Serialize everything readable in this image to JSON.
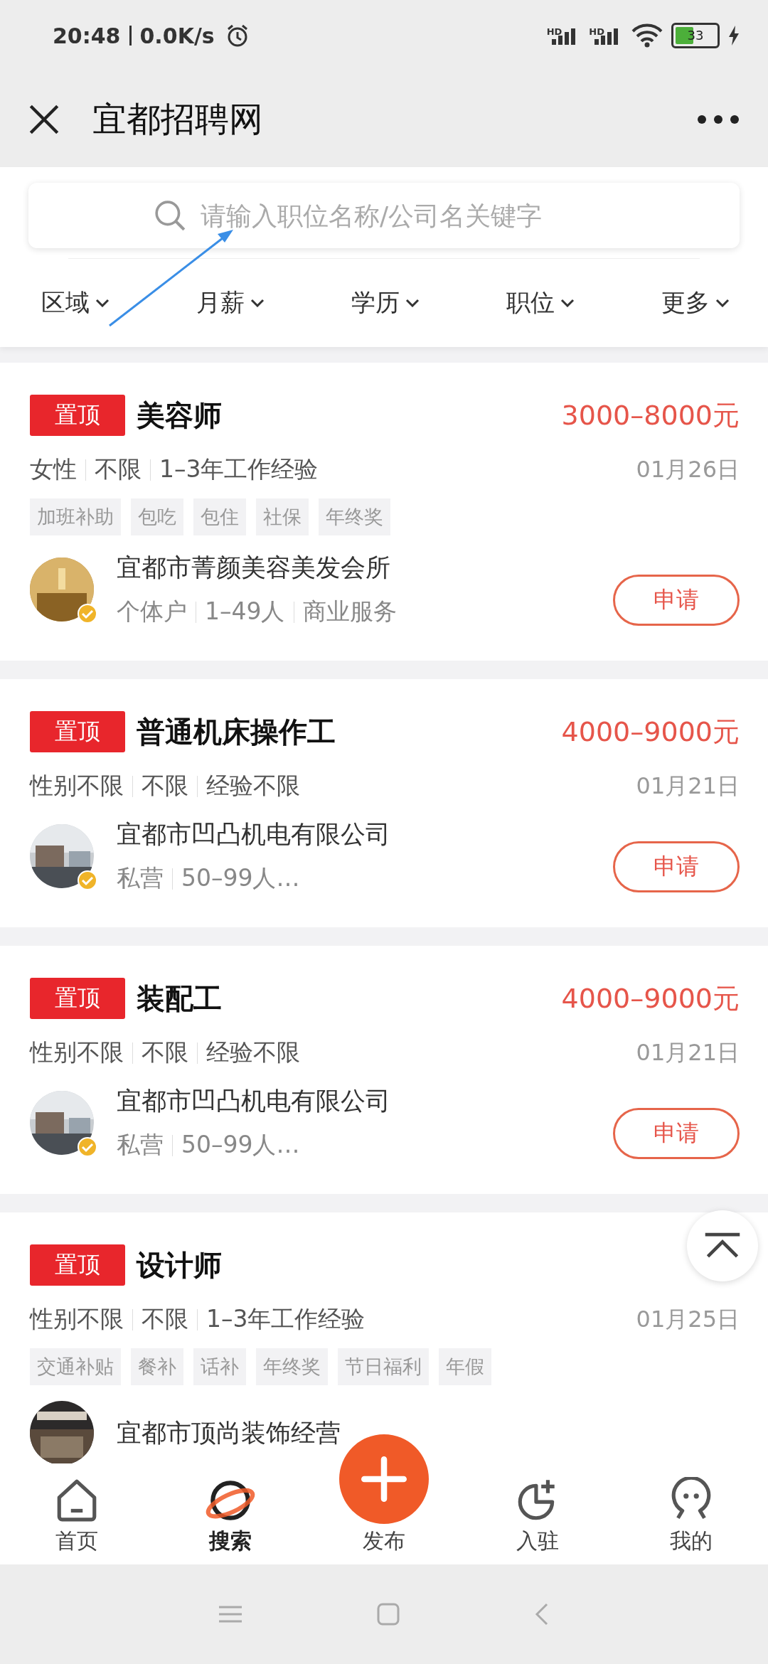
{
  "status_bar": {
    "time": "20:48",
    "speed": "0.0K/s",
    "network": [
      "HD",
      "HD"
    ],
    "battery": "33",
    "charging": true
  },
  "title_bar": {
    "title": "宜都招聘网"
  },
  "search": {
    "placeholder": "请输入职位名称/公司名关键字"
  },
  "filters": [
    {
      "label": "区域"
    },
    {
      "label": "月薪"
    },
    {
      "label": "学历"
    },
    {
      "label": "职位"
    },
    {
      "label": "更多"
    }
  ],
  "jobs": [
    {
      "badge": "置顶",
      "title": "美容师",
      "salary": "3000–8000元",
      "requirements": [
        "女性",
        "不限",
        "1–3年工作经验"
      ],
      "date": "01月26日",
      "benefits": [
        "加班补助",
        "包吃",
        "包住",
        "社保",
        "年终奖"
      ],
      "company": "宜都市菁颜美容美发会所",
      "company_info": [
        "个体户",
        "1–49人",
        "商业服务"
      ],
      "verified": true,
      "apply": "申请"
    },
    {
      "badge": "置顶",
      "title": "普通机床操作工",
      "salary": "4000–9000元",
      "requirements": [
        "性别不限",
        "不限",
        "经验不限"
      ],
      "date": "01月21日",
      "company": "宜都市凹凸机电有限公司",
      "company_info": [
        "私营",
        "50–99人…"
      ],
      "verified": true,
      "apply": "申请"
    },
    {
      "badge": "置顶",
      "title": "装配工",
      "salary": "4000–9000元",
      "requirements": [
        "性别不限",
        "不限",
        "经验不限"
      ],
      "date": "01月21日",
      "company": "宜都市凹凸机电有限公司",
      "company_info": [
        "私营",
        "50–99人…"
      ],
      "verified": true,
      "apply": "申请"
    },
    {
      "badge": "置顶",
      "title": "设计师",
      "requirements": [
        "性别不限",
        "不限",
        "1–3年工作经验"
      ],
      "date": "01月25日",
      "benefits": [
        "交通补贴",
        "餐补",
        "话补",
        "年终奖",
        "节日福利",
        "年假"
      ],
      "company": "宜都市顶尚装饰经营"
    }
  ],
  "nav": [
    {
      "kind": "home",
      "label": "首页",
      "selected": false
    },
    {
      "kind": "search",
      "label": "搜索",
      "selected": true
    },
    {
      "kind": "publish",
      "label": "发布",
      "selected": false
    },
    {
      "kind": "join",
      "label": "入驻",
      "selected": false
    },
    {
      "kind": "profile",
      "label": "我的",
      "selected": false
    }
  ]
}
